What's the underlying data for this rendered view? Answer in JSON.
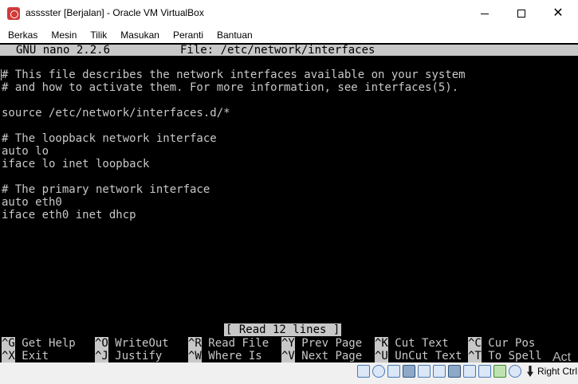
{
  "window": {
    "title": "asssster [Berjalan] - Oracle VM VirtualBox",
    "close_glyph": "✕"
  },
  "menu": {
    "items": [
      "Berkas",
      "Mesin",
      "Tilik",
      "Masukan",
      "Peranti",
      "Bantuan"
    ]
  },
  "nano": {
    "program": "GNU nano 2.2.6",
    "file": "File: /etc/network/interfaces",
    "lines": [
      "",
      "# This file describes the network interfaces available on your system",
      "# and how to activate them. For more information, see interfaces(5).",
      "",
      "source /etc/network/interfaces.d/*",
      "",
      "# The loopback network interface",
      "auto lo",
      "iface lo inet loopback",
      "",
      "# The primary network interface",
      "auto eth0",
      "iface eth0 inet dhcp"
    ],
    "status": "[ Read 12 lines ]",
    "shortcuts_row1": [
      {
        "key": "^G",
        "label": "Get Help"
      },
      {
        "key": "^O",
        "label": "WriteOut"
      },
      {
        "key": "^R",
        "label": "Read File"
      },
      {
        "key": "^Y",
        "label": "Prev Page"
      },
      {
        "key": "^K",
        "label": "Cut Text"
      },
      {
        "key": "^C",
        "label": "Cur Pos"
      }
    ],
    "shortcuts_row2": [
      {
        "key": "^X",
        "label": "Exit"
      },
      {
        "key": "^J",
        "label": "Justify"
      },
      {
        "key": "^W",
        "label": "Where Is"
      },
      {
        "key": "^V",
        "label": "Next Page"
      },
      {
        "key": "^U",
        "label": "UnCut Text"
      },
      {
        "key": "^T",
        "label": "To Spell"
      }
    ]
  },
  "statusbar": {
    "icons": [
      "hard-disk-icon",
      "optical-drive-icon",
      "audio-icon",
      "network-icon",
      "usb-icon",
      "shared-folders-icon",
      "display-icon",
      "recording-icon",
      "video-capture-icon",
      "cpu-icon",
      "mouse-integration-icon"
    ],
    "host_key": "Right Ctrl"
  },
  "overlay": {
    "watermark": "Act"
  }
}
